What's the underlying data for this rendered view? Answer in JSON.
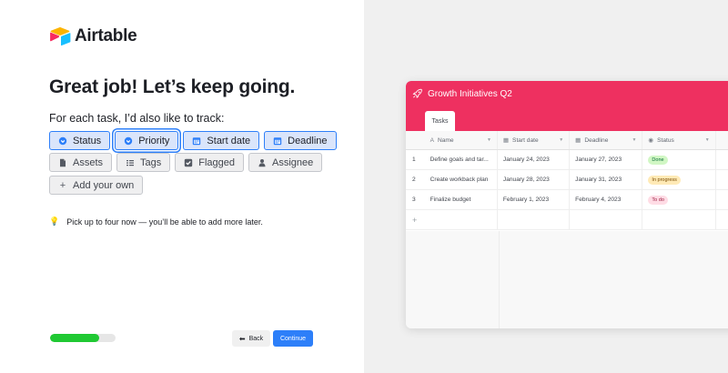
{
  "brand": {
    "name": "Airtable"
  },
  "heading": "Great job! Let’s keep going.",
  "subheading": "For each task, I’d also like to track:",
  "chips_row1": [
    {
      "label": "Status",
      "icon": "status-icon",
      "selected": true
    },
    {
      "label": "Priority",
      "icon": "priority-icon",
      "selected": true,
      "focused": true
    },
    {
      "label": "Start date",
      "icon": "calendar-icon",
      "selected": true
    },
    {
      "label": "Deadline",
      "icon": "calendar-icon",
      "selected": true
    }
  ],
  "chips_row2": [
    {
      "label": "Assets",
      "icon": "attachment-icon",
      "selected": false
    },
    {
      "label": "Tags",
      "icon": "tags-icon",
      "selected": false
    },
    {
      "label": "Flagged",
      "icon": "checkbox-icon",
      "selected": false
    },
    {
      "label": "Assignee",
      "icon": "user-icon",
      "selected": false
    }
  ],
  "add_own": {
    "label": "Add your own",
    "icon": "plus-icon"
  },
  "hint": "Pick up to four now — you’ll be able to add more later.",
  "progress": {
    "value": 0.75
  },
  "buttons": {
    "back": "Back",
    "continue": "Continue"
  },
  "preview": {
    "base_title": "Growth Initiatives Q2",
    "tab": "Tasks",
    "columns": [
      {
        "label": "Name",
        "icon": "A"
      },
      {
        "label": "Start date",
        "icon": "calendar-icon"
      },
      {
        "label": "Deadline",
        "icon": "calendar-icon"
      },
      {
        "label": "Status",
        "icon": "status-icon"
      }
    ],
    "rows": [
      {
        "num": "1",
        "name": "Define goals and tar...",
        "start": "January 24, 2023",
        "deadline": "January 27, 2023",
        "status": "Done"
      },
      {
        "num": "2",
        "name": "Create workback plan",
        "start": "January 28, 2023",
        "deadline": "January 31, 2023",
        "status": "In progress"
      },
      {
        "num": "3",
        "name": "Finalize budget",
        "start": "February 1, 2023",
        "deadline": "February 4, 2023",
        "status": "To do"
      }
    ],
    "status_colors": {
      "Done": {
        "bg": "#d1f7c4",
        "fg": "#0b6e3b"
      },
      "In progress": {
        "bg": "#ffeab6",
        "fg": "#7a4d05"
      },
      "To do": {
        "bg": "#ffdce5",
        "fg": "#9a1a3f"
      }
    }
  },
  "colors": {
    "accent": "#2d7ff9",
    "header": "#ee3060",
    "progress": "#20c933"
  }
}
